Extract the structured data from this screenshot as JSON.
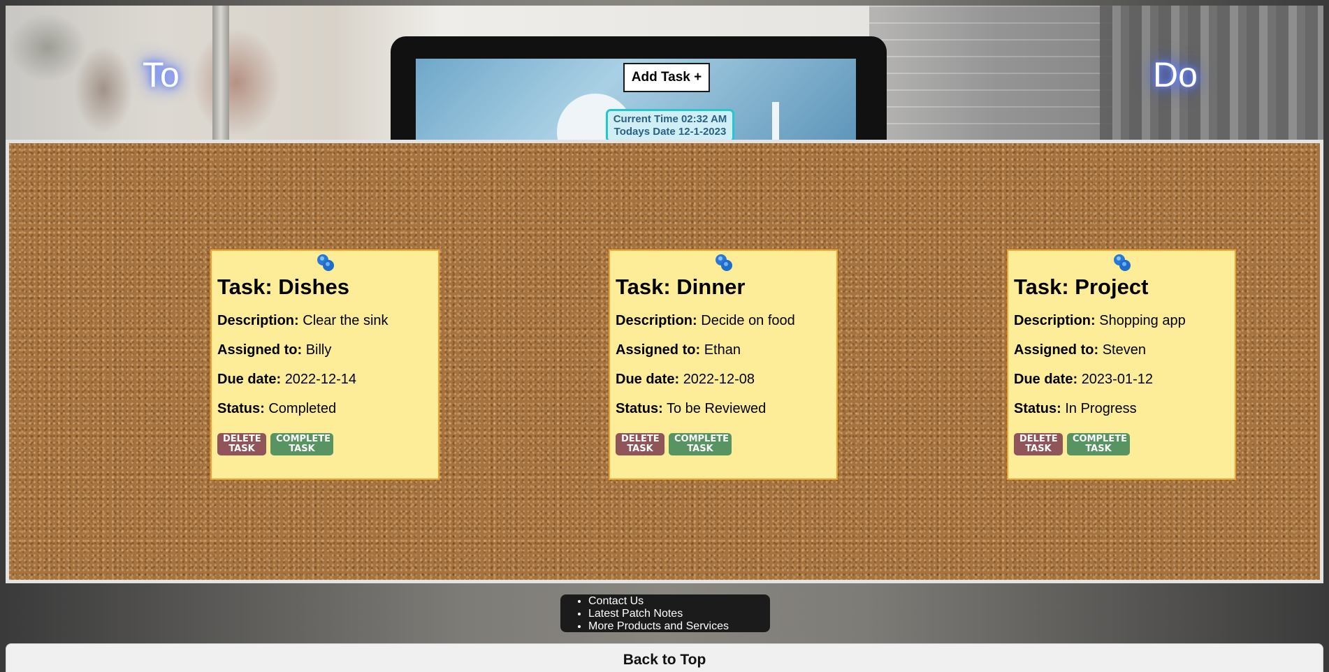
{
  "header": {
    "left_word": "To",
    "right_word": "Do",
    "add_task_label": "Add Task +",
    "clock": {
      "time_line": "Current Time 02:32 AM",
      "date_line": "Todays Date 12-1-2023"
    }
  },
  "tasks": [
    {
      "title": "Task: Dishes",
      "description_label": "Description:",
      "description": "Clear the sink",
      "assigned_label": "Assigned to:",
      "assigned": "Billy",
      "due_label": "Due date:",
      "due": "2022-12-14",
      "status_label": "Status:",
      "status": "Completed",
      "delete_label_1": "DELETE",
      "delete_label_2": "TASK",
      "complete_label_1": "COMPLETE",
      "complete_label_2": "TASK"
    },
    {
      "title": "Task: Dinner",
      "description_label": "Description:",
      "description": "Decide on food",
      "assigned_label": "Assigned to:",
      "assigned": "Ethan",
      "due_label": "Due date:",
      "due": "2022-12-08",
      "status_label": "Status:",
      "status": "To be Reviewed",
      "delete_label_1": "DELETE",
      "delete_label_2": "TASK",
      "complete_label_1": "COMPLETE",
      "complete_label_2": "TASK"
    },
    {
      "title": "Task: Project",
      "description_label": "Description:",
      "description": "Shopping app",
      "assigned_label": "Assigned to:",
      "assigned": "Steven",
      "due_label": "Due date:",
      "due": "2023-01-12",
      "status_label": "Status:",
      "status": "In Progress",
      "delete_label_1": "DELETE",
      "delete_label_2": "TASK",
      "complete_label_1": "COMPLETE",
      "complete_label_2": "TASK"
    }
  ],
  "footer": {
    "links": [
      "Contact Us",
      "Latest Patch Notes",
      "More Products and Services"
    ],
    "back_to_top": "Back to Top"
  },
  "colors": {
    "note_bg": "#fdec98",
    "note_border": "#f0a22c",
    "delete_button": "#8f5558",
    "complete_button": "#589461",
    "clock_border": "#22c7cf",
    "word_glow": "#4a6cff"
  },
  "icons": {
    "pin": "pushpin-icon"
  }
}
